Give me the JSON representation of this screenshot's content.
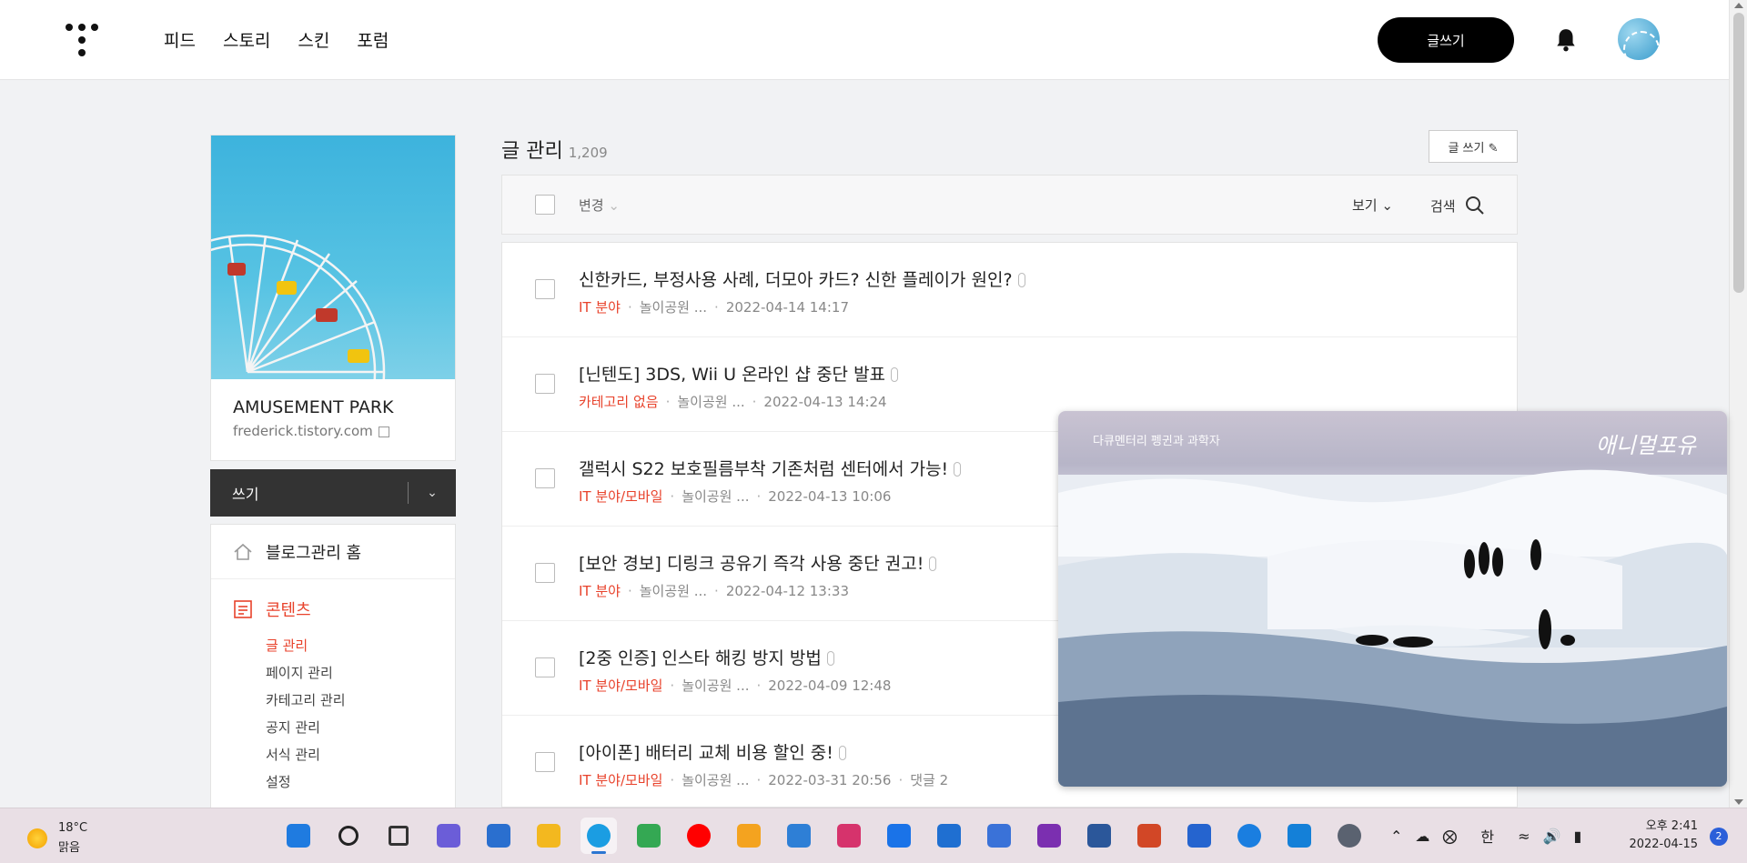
{
  "nav": {
    "items": [
      "피드",
      "스토리",
      "스킨",
      "포럼"
    ],
    "write_button": "글쓰기"
  },
  "sidebar": {
    "blog_name": "AMUSEMENT PARK",
    "blog_url": "frederick.tistory.com",
    "write_dropdown": "쓰기",
    "home_label": "블로그관리 홈",
    "content_label": "콘텐츠",
    "sub_items": [
      "글 관리",
      "페이지 관리",
      "카테고리 관리",
      "공지 관리",
      "서식 관리",
      "설정"
    ]
  },
  "main": {
    "title": "글 관리",
    "count": "1,209",
    "write_button": "글 쓰기",
    "toolbar": {
      "change": "변경",
      "view": "보기",
      "search": "검색"
    },
    "posts": [
      {
        "title": "신한카드, 부정사용 사례, 더모아 카드? 신한 플레이가 원인?",
        "category": "IT 분야",
        "author": "놀이공원 ...",
        "date": "2022-04-14 14:17",
        "extra": ""
      },
      {
        "title": "[닌텐도] 3DS, Wii U 온라인 샵 중단 발표",
        "category": "카테고리 없음",
        "author": "놀이공원 ...",
        "date": "2022-04-13 14:24",
        "extra": ""
      },
      {
        "title": "갤럭시 S22 보호필름부착 기존처럼 센터에서 가능!",
        "category": "IT 분야/모바일",
        "author": "놀이공원 ...",
        "date": "2022-04-13 10:06",
        "extra": ""
      },
      {
        "title": "[보안 경보] 디링크 공유기 즉각 사용 중단 권고!",
        "category": "IT 분야",
        "author": "놀이공원 ...",
        "date": "2022-04-12 13:33",
        "extra": ""
      },
      {
        "title": "[2중 인증] 인스타 해킹 방지 방법",
        "category": "IT 분야/모바일",
        "author": "놀이공원 ...",
        "date": "2022-04-09 12:48",
        "extra": ""
      },
      {
        "title": "[아이폰] 배터리 교체 비용 할인 중!",
        "category": "IT 분야/모바일",
        "author": "놀이공원 ...",
        "date": "2022-03-31 20:56",
        "extra": "댓글 2"
      }
    ]
  },
  "video": {
    "caption_left": "다큐멘터리 펭귄과 과학자",
    "caption_right": "애니멀포유"
  },
  "taskbar": {
    "weather_temp": "18°C",
    "weather_desc": "맑음",
    "ime": "한",
    "time": "오후 2:41",
    "date": "2022-04-15",
    "notifications": "2",
    "apps": [
      {
        "name": "windows-start-icon",
        "color": "#1f7be0"
      },
      {
        "name": "search-icon",
        "color": "#222222"
      },
      {
        "name": "task-view-icon",
        "color": "#333333"
      },
      {
        "name": "teams-chat-icon",
        "color": "#6b5dd8"
      },
      {
        "name": "store-icon",
        "color": "#2a6fcf"
      },
      {
        "name": "file-explorer-icon",
        "color": "#f3b81f"
      },
      {
        "name": "edge-browser-icon",
        "color": "#1b9de2"
      },
      {
        "name": "maps-icon",
        "color": "#34a853"
      },
      {
        "name": "youtube-music-icon",
        "color": "#ff0000"
      },
      {
        "name": "photos-icon",
        "color": "#f4a31f"
      },
      {
        "name": "gallery-icon",
        "color": "#2e7fd6"
      },
      {
        "name": "instagram-icon",
        "color": "#d6336c"
      },
      {
        "name": "mail-icon",
        "color": "#1a73e8"
      },
      {
        "name": "calendar-icon",
        "color": "#1f6fd1"
      },
      {
        "name": "people-icon",
        "color": "#3a72d8"
      },
      {
        "name": "onenote-icon",
        "color": "#7b2fb0"
      },
      {
        "name": "word-icon",
        "color": "#2b579a"
      },
      {
        "name": "powerpoint-icon",
        "color": "#d24726"
      },
      {
        "name": "todo-icon",
        "color": "#2564cf"
      },
      {
        "name": "onedrive-icon",
        "color": "#1a7ee0"
      },
      {
        "name": "remote-desktop-icon",
        "color": "#1480d8"
      },
      {
        "name": "settings-icon",
        "color": "#5a6270"
      }
    ]
  },
  "colors": {
    "accent": "#e8422b",
    "dark": "#333333"
  }
}
